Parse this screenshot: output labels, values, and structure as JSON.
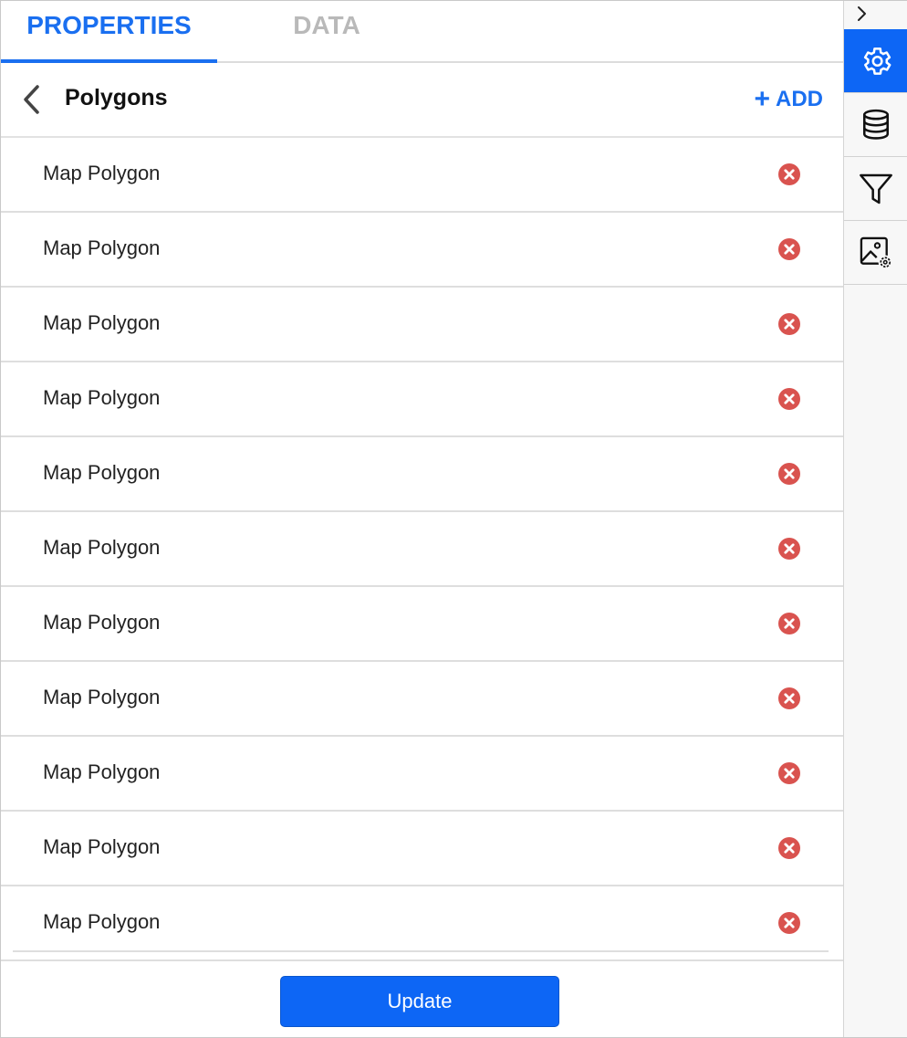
{
  "tabs": {
    "properties": "PROPERTIES",
    "data": "DATA"
  },
  "header": {
    "title": "Polygons",
    "add_label": "ADD"
  },
  "items": [
    {
      "label": "Map Polygon"
    },
    {
      "label": "Map Polygon"
    },
    {
      "label": "Map Polygon"
    },
    {
      "label": "Map Polygon"
    },
    {
      "label": "Map Polygon"
    },
    {
      "label": "Map Polygon"
    },
    {
      "label": "Map Polygon"
    },
    {
      "label": "Map Polygon"
    },
    {
      "label": "Map Polygon"
    },
    {
      "label": "Map Polygon"
    },
    {
      "label": "Map Polygon"
    }
  ],
  "update_label": "Update",
  "rail": {
    "collapse_icon": "chevron-right-icon",
    "buttons": [
      {
        "icon": "gear-icon",
        "active": true
      },
      {
        "icon": "database-icon",
        "active": false
      },
      {
        "icon": "filter-icon",
        "active": false
      },
      {
        "icon": "image-settings-icon",
        "active": false
      }
    ]
  },
  "colors": {
    "accent": "#1a6ff0",
    "remove": "#d9534f",
    "inactive_tab": "#b9b9b9"
  }
}
